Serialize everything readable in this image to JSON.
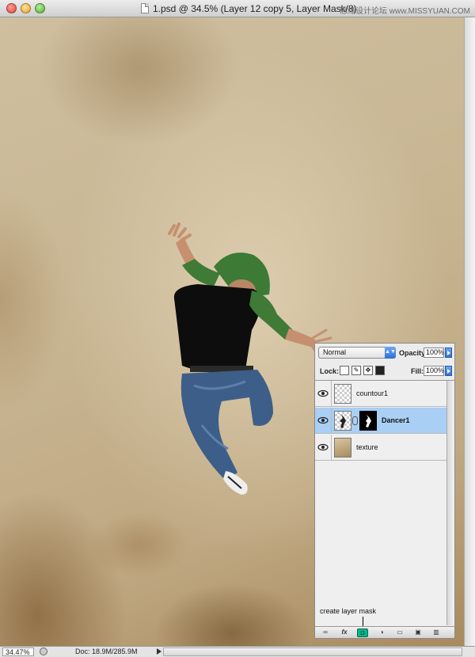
{
  "window": {
    "title": "1.psd @ 34.5% (Layer 12 copy 5, Layer Mask/8)",
    "watermark": "思缘设计论坛  www.MISSYUAN.COM"
  },
  "status_bar": {
    "zoom": "34.47%",
    "doc_size": "Doc: 18.9M/285.9M"
  },
  "layers_panel": {
    "blend_mode": "Normal",
    "opacity_label": "Opacity:",
    "opacity_value": "100%",
    "lock_label": "Lock:",
    "fill_label": "Fill:",
    "fill_value": "100%",
    "layers": [
      {
        "name": "countour1",
        "visible": true,
        "selected": false
      },
      {
        "name": "Dancer1",
        "visible": true,
        "selected": true
      },
      {
        "name": "texture",
        "visible": true,
        "selected": false
      }
    ],
    "callout": "create layer mask",
    "toolbar_icons": [
      "link-icon",
      "fx-icon",
      "layer-mask-icon",
      "adjustment-layer-icon",
      "group-folder-icon",
      "new-layer-icon",
      "trash-icon"
    ],
    "fx_label": "fx"
  },
  "colors": {
    "selection": "#a9cff4",
    "accent_blue": "#2f6fd6",
    "mask_button": "#00bb88"
  }
}
